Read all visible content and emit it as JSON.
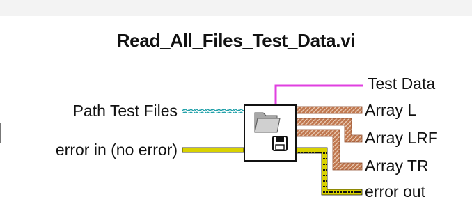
{
  "vi": {
    "title": "Read_All_Files_Test_Data.vi"
  },
  "inputs": {
    "path_test_files": "Path Test Files",
    "error_in": "error in (no error)"
  },
  "outputs": {
    "test_data": "Test Data",
    "array_l": "Array L",
    "array_lrf": "Array LRF",
    "array_tr": "Array TR",
    "error_out": "error out"
  },
  "icon": {
    "glyphs": [
      "folder-icon",
      "floppy-disk-icon"
    ]
  },
  "wire_colors": {
    "path": "#1e9fa8",
    "error": "#d9d200",
    "array": "#c07850",
    "variant": "#e040e0"
  }
}
